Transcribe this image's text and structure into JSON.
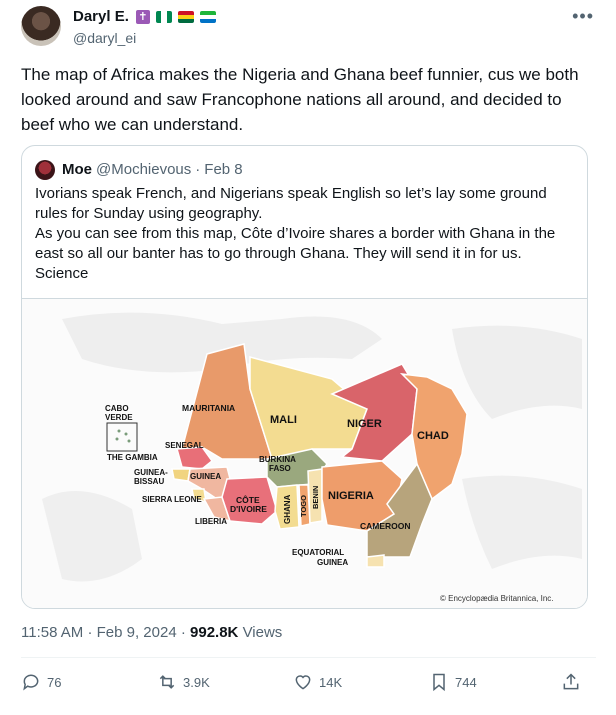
{
  "author": {
    "name": "Daryl E.",
    "handle": "@daryl_ei",
    "badges": [
      "cross-icon",
      "nigeria-flag-icon",
      "ghana-flag-icon",
      "sierra-leone-flag-icon"
    ],
    "cross_glyph": "✝"
  },
  "tweet": {
    "text": "The map of Africa makes the Nigeria and Ghana beef funnier, cus we both looked around and saw Francophone nations all around, and decided to beef who we can understand."
  },
  "quote": {
    "name": "Moe",
    "handle": "@Mochievous",
    "separator": "·",
    "date": "Feb 8",
    "lines": [
      "Ivorians speak French, and Nigerians speak English so let’s lay some ground",
      "rules for Sunday using geography.",
      "As you can see from this map, Côte d’Ivoire shares a border with Ghana in the",
      "east so all our banter has to go through Ghana. They will send it in for us.",
      "Science"
    ],
    "map": {
      "labels": {
        "mauritania": "MAURITANIA",
        "mali": "MALI",
        "niger": "NIGER",
        "chad": "CHAD",
        "cabo1": "CABO",
        "cabo2": "VERDE",
        "senegal": "SENEGAL",
        "gambia": "THE GAMBIA",
        "gb1": "GUINEA-",
        "gb2": "BISSAU",
        "guinea": "GUINEA",
        "sierra": "SIERRA LEONE",
        "liberia": "LIBERIA",
        "cote1": "CÔTE",
        "cote2": "D'IVOIRE",
        "bf1": "BURKINA",
        "bf2": "FASO",
        "ghana": "GHANA",
        "togo": "TOGO",
        "benin": "BENIN",
        "nigeria": "NIGERIA",
        "cameroon": "CAMEROON",
        "eq1": "EQUATORIAL",
        "eq2": "GUINEA",
        "credit": "© Encyclopædia Britannica, Inc."
      }
    }
  },
  "timestamp": {
    "time": "11:58 AM",
    "sep1": "·",
    "date": "Feb 9, 2024",
    "sep2": "·",
    "views_count": "992.8K",
    "views_label": "Views"
  },
  "actions": {
    "replies": "76",
    "reposts": "3.9K",
    "likes": "14K",
    "bookmarks": "744"
  },
  "colors": {
    "text": "#0f1419",
    "secondary": "#536471",
    "border": "#cfd9de"
  }
}
